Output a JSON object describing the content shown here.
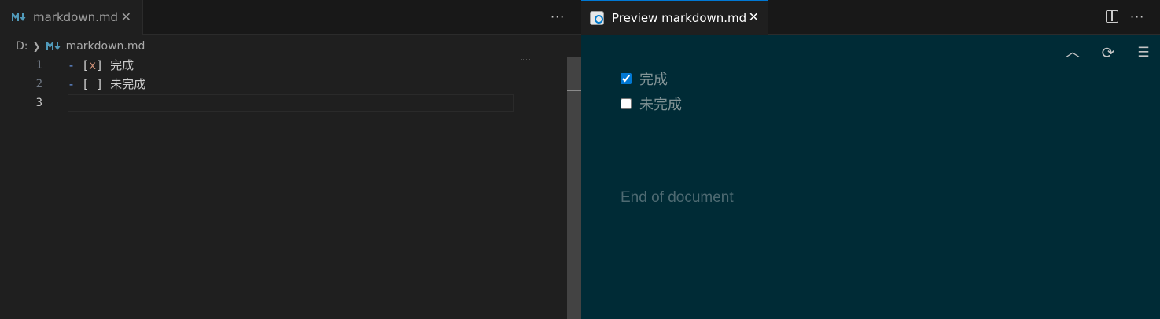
{
  "left_editor": {
    "tab": {
      "label": "markdown.md",
      "close": "✕"
    },
    "more_actions": "···",
    "breadcrumb": {
      "drive": "D:",
      "file": "markdown.md"
    },
    "lines": [
      {
        "number": "1",
        "dash": "-",
        "open": " [",
        "mark": "x",
        "close": "]",
        "text": " 完成"
      },
      {
        "number": "2",
        "dash": "-",
        "open": " [",
        "mark": " ",
        "close": "]",
        "text": " 未完成"
      },
      {
        "number": "3",
        "dash": "",
        "open": "",
        "mark": "",
        "close": "",
        "text": ""
      }
    ]
  },
  "preview": {
    "tab": {
      "label": "Preview markdown.md",
      "close": "✕"
    },
    "more_actions": "···",
    "toolbar": {
      "up": "︿",
      "refresh": "⟳",
      "outline": "☰"
    },
    "tasks": [
      {
        "label": "完成",
        "checked": true
      },
      {
        "label": "未完成",
        "checked": false
      }
    ],
    "end_of_document": "End of document"
  },
  "colors": {
    "accent": "#0078d4",
    "editor_bg": "#1f1f1f",
    "preview_bg": "#002b36",
    "markdown_icon": "#519aba"
  }
}
